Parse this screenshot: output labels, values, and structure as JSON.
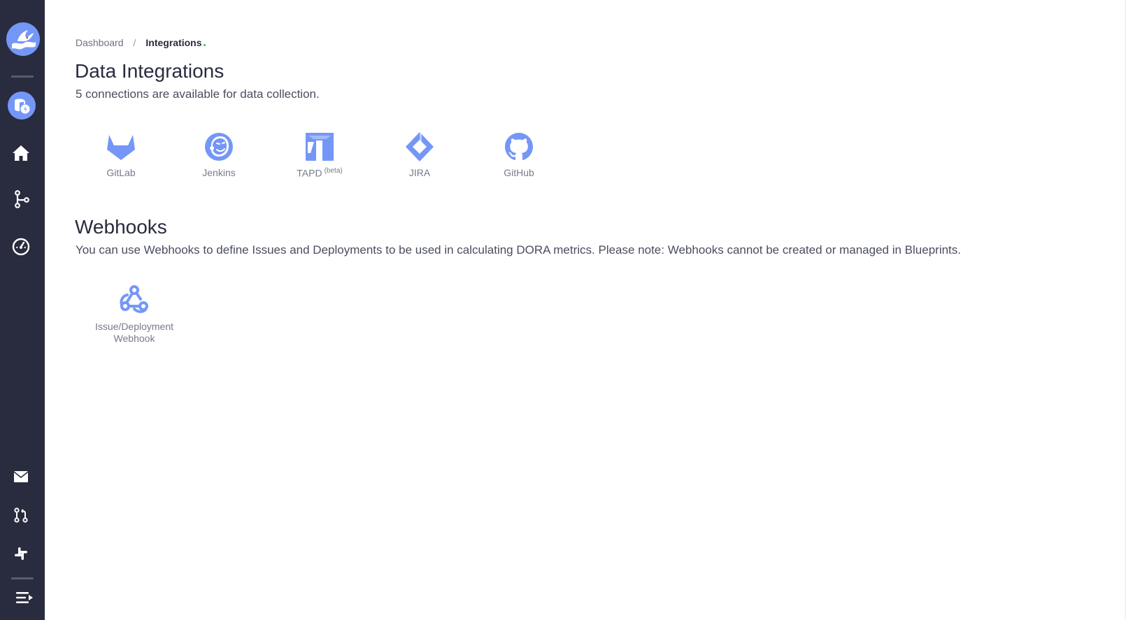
{
  "breadcrumb": {
    "root": "Dashboard",
    "separator": "/",
    "current": "Integrations"
  },
  "page": {
    "title": "Data Integrations",
    "subtitle": "5 connections are available for data collection."
  },
  "integrations": [
    {
      "label": "GitLab",
      "icon": "gitlab-icon"
    },
    {
      "label": "Jenkins",
      "icon": "jenkins-icon"
    },
    {
      "label": "TAPD",
      "badge": "(beta)",
      "icon": "tapd-icon"
    },
    {
      "label": "JIRA",
      "icon": "jira-icon"
    },
    {
      "label": "GitHub",
      "icon": "github-icon"
    }
  ],
  "webhooks": {
    "title": "Webhooks",
    "description": "You can use Webhooks to define Issues and Deployments to be used in calculating DORA metrics. Please note: Webhooks cannot be created or managed in Blueprints.",
    "items": [
      {
        "label_line1": "Issue/Deployment",
        "label_line2": "Webhook",
        "icon": "webhook-icon"
      }
    ]
  },
  "sidebar": {
    "items": [
      "logo-icon",
      "database-icon",
      "home-icon",
      "git-branch-icon",
      "dashboard-gauge-icon",
      "mail-icon",
      "pull-request-icon",
      "slack-icon",
      "collapse-menu-icon"
    ]
  },
  "colors": {
    "sidebar_bg": "#292b3f",
    "accent": "#7497f7",
    "text_dark": "#292b3f"
  }
}
